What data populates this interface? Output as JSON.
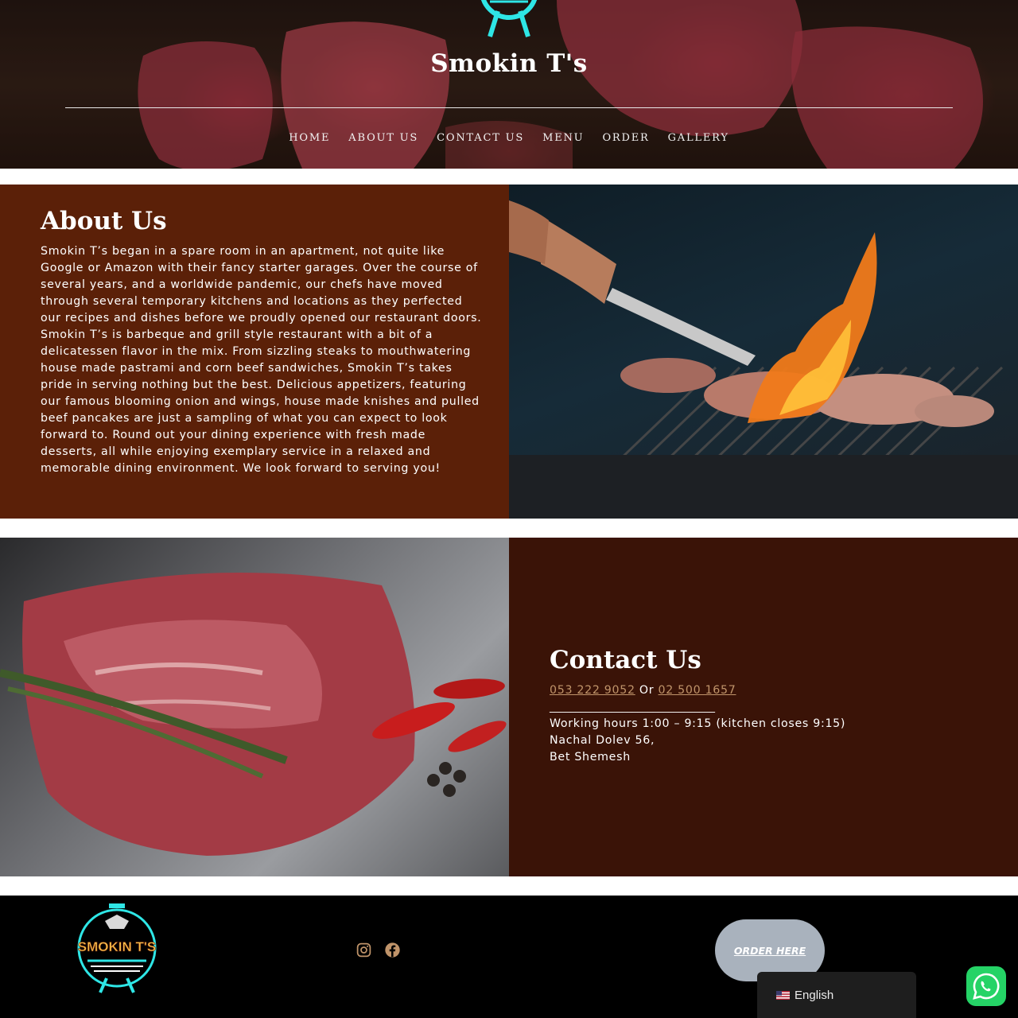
{
  "header": {
    "site_title": "Smokin T's",
    "nav": [
      {
        "label": "HOME"
      },
      {
        "label": "ABOUT US"
      },
      {
        "label": "CONTACT US"
      },
      {
        "label": "MENU"
      },
      {
        "label": "ORDER"
      },
      {
        "label": "GALLERY"
      }
    ]
  },
  "about": {
    "heading": "About Us",
    "body": "Smokin T’s began in a spare room in an apartment, not quite like Google or Amazon with their fancy starter garages. Over the course of several years, and a worldwide pandemic, our chefs have moved through several temporary kitchens and locations as they perfected our recipes and dishes before we proudly opened our restaurant doors. Smokin T’s is barbeque and grill style restaurant with a bit of a delicatessen flavor in the mix. From sizzling steaks to mouthwatering house made pastrami and corn beef sandwiches, Smokin T’s takes pride in serving nothing but the best. Delicious appetizers, featuring our famous blooming onion and wings, house made knishes and pulled beef pancakes are just a sampling of what you can expect to look forward to. Round out your dining experience with fresh made desserts, all while enjoying exemplary service in a relaxed and memorable dining environment. We look forward to serving you!"
  },
  "contact": {
    "heading": "Contact Us",
    "phone_1": "053 222 9052",
    "or_text": " Or ",
    "phone_2": "02 500 1657",
    "divider": "________________________________",
    "hours": "Working hours 1:00 – 9:15 (kitchen closes 9:15)",
    "address_line_1": "Nachal Dolev 56,",
    "address_line_2": "Bet Shemesh"
  },
  "footer": {
    "logo_text": "SMOKIN T'S",
    "social": [
      {
        "icon": "instagram-icon"
      },
      {
        "icon": "facebook-icon"
      }
    ],
    "order_label": "ORDER HERE",
    "language_label": "English",
    "whatsapp_icon": "whatsapp-icon"
  },
  "colors": {
    "about_panel": "#5b2008",
    "contact_panel": "#3a1307",
    "phone_link": "#c0946a",
    "brand_cyan": "#2ee6e6",
    "order_button": "#a9b2bd",
    "whatsapp": "#25d366"
  }
}
